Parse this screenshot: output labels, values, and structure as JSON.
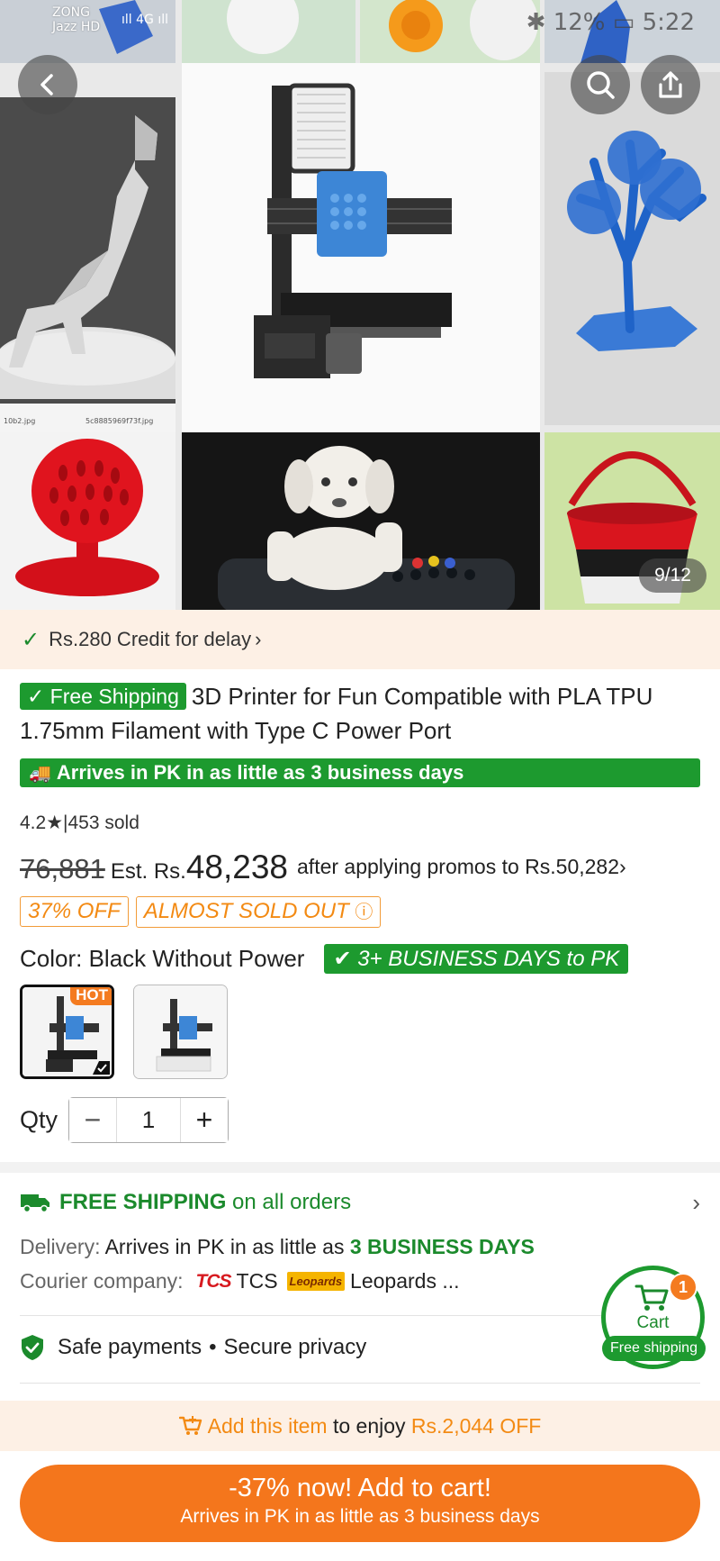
{
  "status_bar": {
    "carrier1": "ZONG",
    "carrier2": "Jazz HD",
    "network": "4G",
    "battery": "12%",
    "time": "5:22"
  },
  "gallery": {
    "counter": "9/12",
    "thumbnail_files": [
      "10b2.jpg",
      "5c8885969f73f.jpg"
    ],
    "buttons": {
      "back_icon": "chevron-left",
      "search_icon": "search",
      "share_icon": "share"
    }
  },
  "credit": {
    "text": "Rs.280 Credit for delay",
    "chevron": "›"
  },
  "product": {
    "free_shipping_badge": "Free Shipping",
    "title": "3D Printer  for Fun Compatible with PLA TPU 1.75mm Filament with Type C Power Port",
    "arrives_strip": "Arrives in PK in as little as 3 business days",
    "rating": "4.2",
    "sold": "|453 sold",
    "original_price": "76,881",
    "est_label": "Est. Rs.",
    "est_price": "48,238",
    "promo_text": "after applying promos to",
    "promo_price": "Rs.50,282",
    "promo_chevron": "›",
    "badges": [
      "37% OFF",
      "ALMOST SOLD OUT"
    ],
    "color_label": "Color:",
    "color_value": "Black Without Power",
    "days_badge": "✔ 3+ BUSINESS DAYS to PK",
    "hot_label": "HOT",
    "qty_label": "Qty",
    "qty_value": "1",
    "qty_minus": "−",
    "qty_plus": "+"
  },
  "shipping": {
    "title_bold": "FREE SHIPPING",
    "title_rest": "on all orders",
    "delivery_label": "Delivery:",
    "delivery_text": "Arrives in PK in as little as",
    "delivery_highlight": "3 BUSINESS DAYS",
    "courier_label": "Courier company:",
    "courier_tcs_logo": "TCS",
    "courier_tcs": "TCS",
    "courier_leopards_logo": "Leopards",
    "courier_leopards": "Leopards ...",
    "safe_text": "Safe payments",
    "secure_text": "Secure privacy"
  },
  "cart": {
    "label": "Cart",
    "count": "1",
    "shipping_tag": "Free shipping"
  },
  "promo_bar": {
    "link": "Add this item",
    "middle": "to enjoy",
    "amount": "Rs.2,044 OFF"
  },
  "cta": {
    "main": "-37% now! Add to cart!",
    "sub": "Arrives in PK in as little as 3 business days"
  },
  "colors": {
    "green": "#1d9a2f",
    "orange": "#f4761c",
    "cream": "#fdf0e5"
  }
}
